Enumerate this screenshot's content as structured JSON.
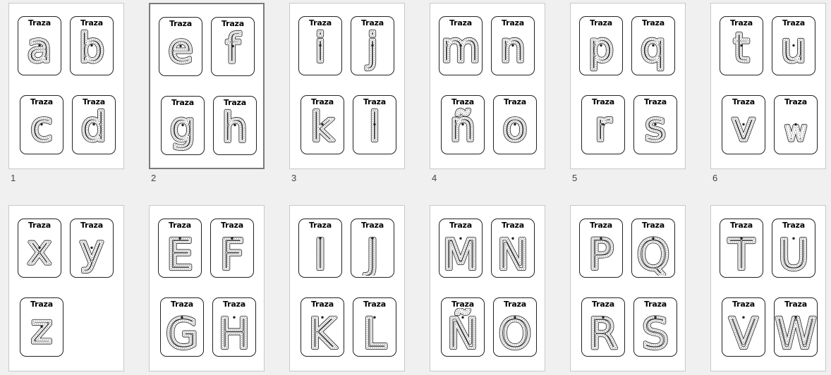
{
  "card_label": "Traza",
  "slides": [
    {
      "number": "1",
      "letters": [
        "a",
        "b",
        "c",
        "d"
      ]
    },
    {
      "number": "2",
      "letters": [
        "e",
        "f",
        "g",
        "h"
      ]
    },
    {
      "number": "3",
      "letters": [
        "i",
        "j",
        "k",
        "l"
      ]
    },
    {
      "number": "4",
      "letters": [
        "m",
        "n",
        "ñ",
        "o"
      ]
    },
    {
      "number": "5",
      "letters": [
        "p",
        "q",
        "r",
        "s"
      ]
    },
    {
      "number": "6",
      "letters": [
        "t",
        "u",
        "v",
        "w"
      ]
    },
    {
      "number": "",
      "letters": [
        "x",
        "y",
        "z"
      ]
    },
    {
      "number": "",
      "letters": [
        "E",
        "F",
        "G",
        "H"
      ]
    },
    {
      "number": "",
      "letters": [
        "I",
        "J",
        "K",
        "L"
      ]
    },
    {
      "number": "",
      "letters": [
        "M",
        "N",
        "Ñ",
        "O"
      ]
    },
    {
      "number": "",
      "letters": [
        "P",
        "Q",
        "R",
        "S"
      ]
    },
    {
      "number": "",
      "letters": [
        "T",
        "U",
        "V",
        "W"
      ]
    }
  ],
  "selected_slide": 2
}
